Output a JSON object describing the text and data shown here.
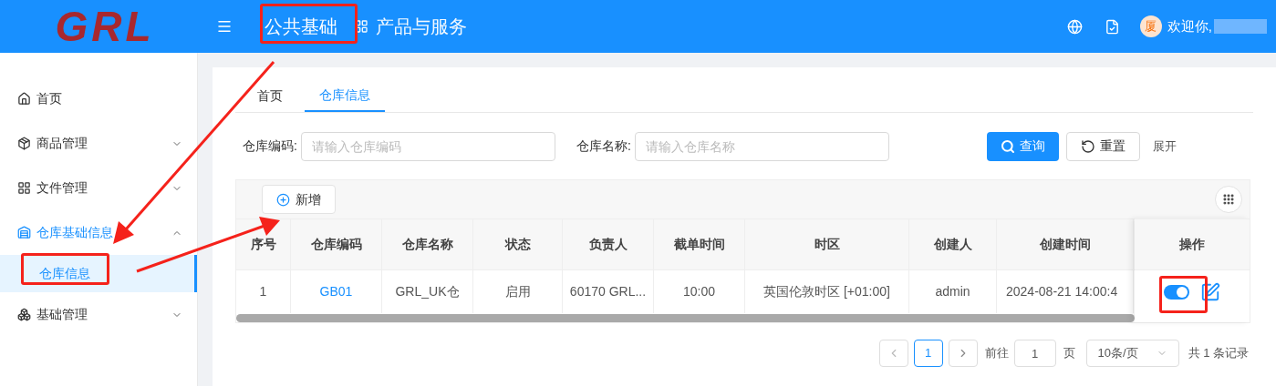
{
  "header": {
    "logo": "GRL",
    "menu_items": [
      {
        "label": "公共基础",
        "selected": true
      },
      {
        "label": "产品与服务",
        "selected": false
      }
    ],
    "greeting": "欢迎你,",
    "avatar_text": "厦"
  },
  "sidebar": {
    "items": [
      {
        "label": "首页",
        "selected": false
      },
      {
        "label": "商品管理",
        "expanded": false
      },
      {
        "label": "文件管理",
        "expanded": false
      },
      {
        "label": "仓库基础信息",
        "expanded": true,
        "children": [
          {
            "label": "仓库信息",
            "selected": true
          }
        ]
      },
      {
        "label": "基础管理",
        "expanded": false
      }
    ]
  },
  "tabs": [
    {
      "label": "首页",
      "selected": false
    },
    {
      "label": "仓库信息",
      "selected": true
    }
  ],
  "filters": [
    {
      "label": "仓库编码:",
      "placeholder": "请输入仓库编码"
    },
    {
      "label": "仓库名称:",
      "placeholder": "请输入仓库名称"
    }
  ],
  "filter_actions": {
    "search": "查询",
    "reset": "重置",
    "expand": "展开"
  },
  "toolbar": {
    "add": "新增"
  },
  "table": {
    "columns": [
      "序号",
      "仓库编码",
      "仓库名称",
      "状态",
      "负责人",
      "截单时间",
      "时区",
      "创建人",
      "创建时间",
      "操作"
    ],
    "rows": [
      {
        "cells": [
          {
            "kind": "text",
            "text": "1"
          },
          {
            "kind": "link",
            "text": "GB01"
          },
          {
            "kind": "text",
            "text": "GRL_UK仓"
          },
          {
            "kind": "text",
            "text": "启用"
          },
          {
            "kind": "text",
            "text": "60170 GRL..."
          },
          {
            "kind": "text",
            "text": "10:00"
          },
          {
            "kind": "text",
            "text": "英国伦敦时区 [+01:00]"
          },
          {
            "kind": "text",
            "text": "admin"
          },
          {
            "kind": "text",
            "text": "2024-08-21 14:00:4"
          }
        ],
        "enabled": true
      }
    ]
  },
  "pagination": {
    "pages": [
      {
        "label": "1",
        "selected": true
      }
    ],
    "goto_label": "前往",
    "goto_value": "1",
    "page_unit": "页",
    "page_size": "10条/页",
    "total": "共 1 条记录"
  }
}
